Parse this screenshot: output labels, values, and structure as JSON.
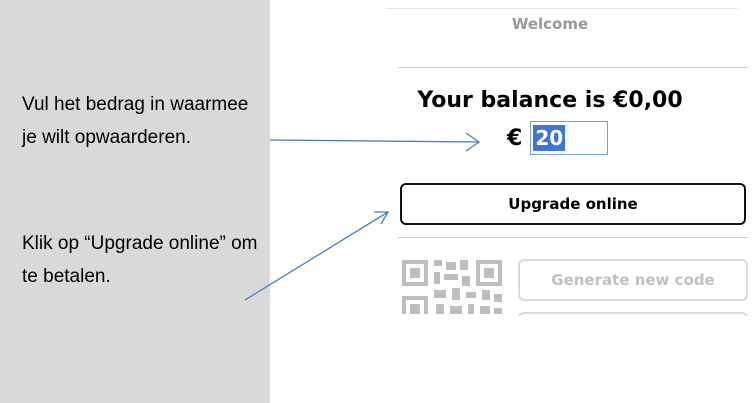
{
  "callout": {
    "paragraph1": "Vul het bedrag in waarmee je wilt opwaarderen.",
    "paragraph2": "Klik op “Upgrade online” om te betalen."
  },
  "panel": {
    "title": "Welcome",
    "balance_text": "Your balance is €0,00",
    "currency_symbol": "€",
    "amount_value": "20",
    "upgrade_button_label": "Upgrade online",
    "generate_button_label": "Generate new code"
  },
  "colors": {
    "callout_bg": "#d9d9d9",
    "arrow": "#4a7ebb",
    "selection": "#3f76d4",
    "disabled_text": "#c0c0c0"
  },
  "icons": [
    "qr-code-icon"
  ]
}
